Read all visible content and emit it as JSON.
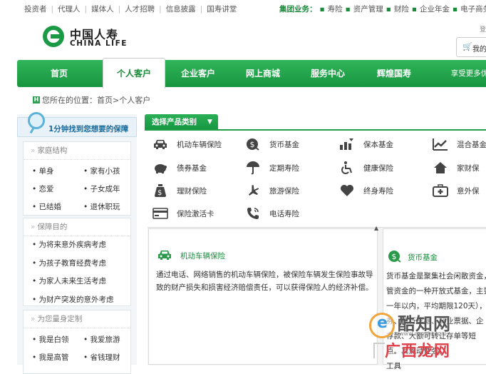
{
  "top_links": {
    "left": [
      "投资者",
      "代理人",
      "媒体人",
      "人才招聘",
      "信息披露",
      "国寿讲堂"
    ],
    "group_label": "集团业务：",
    "right": [
      "寿险",
      "资产管理",
      "财险",
      "企业年金",
      "电子商务"
    ]
  },
  "logo": {
    "cn": "中国人寿",
    "en": "CHINA LIFE"
  },
  "top_right_fragment": "登",
  "cart": {
    "label": "我的"
  },
  "nav": {
    "items": [
      "首页",
      "个人客户",
      "企业客户",
      "网上商城",
      "服务中心",
      "辉煌国寿"
    ],
    "active_index": 1,
    "more": "享受更多优"
  },
  "breadcrumb": {
    "prefix": "您所在的位置：",
    "home": "首页",
    "sep": " > ",
    "current": "个人客户"
  },
  "sidebar": {
    "header": "1分钟找到您想要的保障",
    "family": {
      "title": "家庭结构",
      "items": [
        "单身",
        "家有小孩",
        "恋爱",
        "子女成年",
        "已结婚",
        "退休职玩"
      ]
    },
    "purpose": {
      "title": "保障目的",
      "items": [
        "为将来意外疾病考虑",
        "为孩子教育经费考虑",
        "为家人未来生活考虑",
        "为财产突发的意外考虑"
      ]
    },
    "custom": {
      "title": "为您量身定制",
      "items": [
        "我是白领",
        "我爱旅游",
        "我是高管",
        "省钱理财"
      ]
    }
  },
  "category_tab": "选择产品类别",
  "products": [
    {
      "label": "机动车辆保险",
      "icon": "car-icon"
    },
    {
      "label": "货币基金",
      "icon": "money-bag-icon"
    },
    {
      "label": "保本基金",
      "icon": "bar-chart-icon"
    },
    {
      "label": "混合基金",
      "icon": "trend-icon"
    },
    {
      "label": "债券基金",
      "icon": "piggy-bank-icon"
    },
    {
      "label": "定期寿险",
      "icon": "umbrella-icon"
    },
    {
      "label": "健康保险",
      "icon": "wheelchair-icon"
    },
    {
      "label": "家财保",
      "icon": "house-icon"
    },
    {
      "label": "理财保险",
      "icon": "money-sack-icon"
    },
    {
      "label": "旅游保险",
      "icon": "airplane-icon"
    },
    {
      "label": "终身寿险",
      "icon": "heart-icon"
    },
    {
      "label": "意外保",
      "icon": "medkit-icon"
    },
    {
      "label": "保险激活卡",
      "icon": "card-icon"
    },
    {
      "label": "电话寿险",
      "icon": "phone-icon"
    }
  ],
  "detail_cards": [
    {
      "title": "机动车辆保险",
      "text": "通过电话、网络销售的机动车辆保险，被保险车辆发生保险事故导致的财产损失和损害经济赔偿责任，可以获得保险人的经济补偿。"
    },
    {
      "title": "货币基金",
      "lines": [
        "货币基金是聚集社会闲散资金，",
        "管资金的一种开放式基金，主要",
        "一年以内，平均期限120天），",
        "券、央行票据、商业票据、企",
        "存款、大额可转让存单等短",
        "点。其流动性强，",
        "工具"
      ]
    }
  ],
  "watermark": {
    "brand": "酷知网",
    "url": "www.coozhi.com",
    "sub": "广西龙网"
  }
}
